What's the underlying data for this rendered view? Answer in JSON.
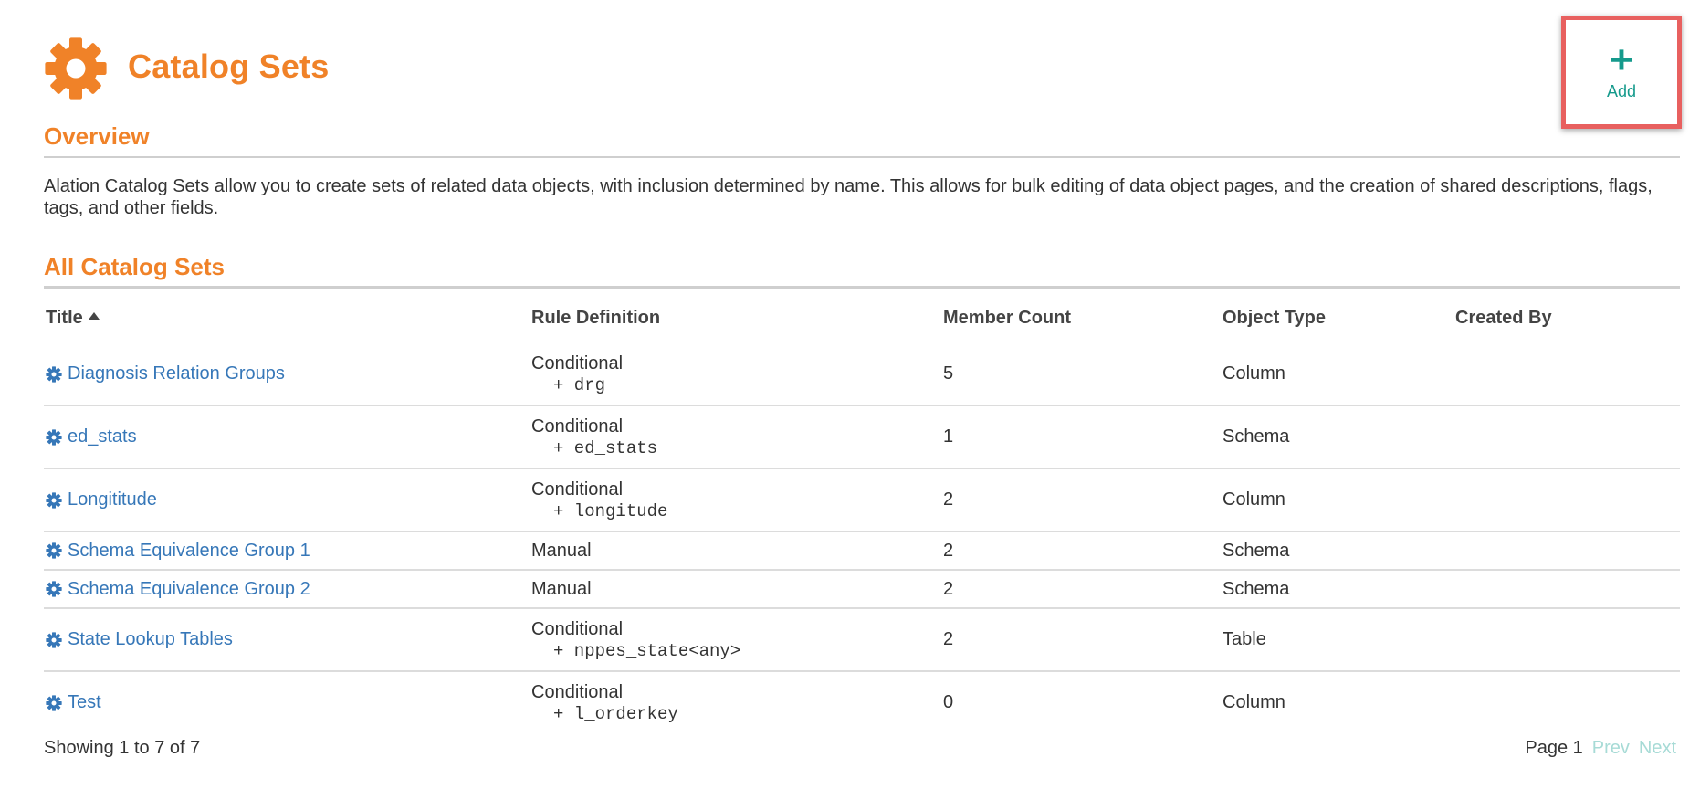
{
  "header": {
    "title": "Catalog Sets",
    "logo_icon": "gear-icon",
    "accent_color": "#f08228",
    "add_label": "Add",
    "add_icon": "plus-icon"
  },
  "overview": {
    "title": "Overview",
    "text": "Alation Catalog Sets allow you to create sets of related data objects, with inclusion determined by name. This allows for bulk editing of data object pages, and the creation of shared descriptions, flags, tags, and other fields."
  },
  "list": {
    "title": "All Catalog Sets",
    "columns": [
      "Title",
      "Rule Definition",
      "Member Count",
      "Object Type",
      "Created By"
    ],
    "rows": [
      {
        "title": "Diagnosis Relation Groups",
        "rule_type": "Conditional",
        "rule_expr": "+ drg",
        "count": "5",
        "object_type": "Column",
        "created_by": ""
      },
      {
        "title": "ed_stats",
        "rule_type": "Conditional",
        "rule_expr": "+ ed_stats",
        "count": "1",
        "object_type": "Schema",
        "created_by": ""
      },
      {
        "title": "Longititude",
        "rule_type": "Conditional",
        "rule_expr": "+ longitude",
        "count": "2",
        "object_type": "Column",
        "created_by": ""
      },
      {
        "title": "Schema Equivalence Group 1",
        "rule_type": "Manual",
        "rule_expr": "",
        "count": "2",
        "object_type": "Schema",
        "created_by": ""
      },
      {
        "title": "Schema Equivalence Group 2",
        "rule_type": "Manual",
        "rule_expr": "",
        "count": "2",
        "object_type": "Schema",
        "created_by": ""
      },
      {
        "title": "State Lookup Tables",
        "rule_type": "Conditional",
        "rule_expr": "+ nppes_state<any>",
        "count": "2",
        "object_type": "Table",
        "created_by": ""
      },
      {
        "title": "Test",
        "rule_type": "Conditional",
        "rule_expr": "+ l_orderkey",
        "count": "0",
        "object_type": "Column",
        "created_by": ""
      }
    ]
  },
  "footer": {
    "showing": "Showing 1 to 7 of 7",
    "page": "Page 1",
    "prev": "Prev",
    "next": "Next"
  }
}
